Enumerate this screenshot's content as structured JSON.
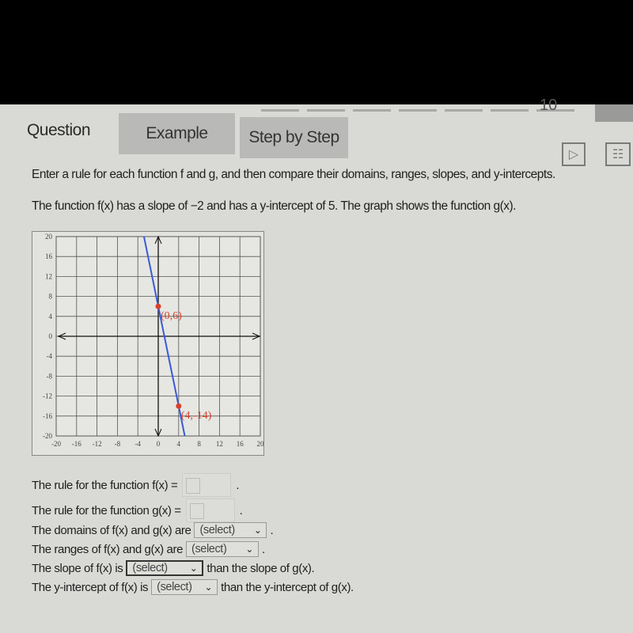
{
  "progress": {
    "visible_number": "10"
  },
  "tabs": [
    {
      "label": "Question"
    },
    {
      "label": "Example"
    },
    {
      "label": "Step by Step"
    }
  ],
  "icons": {
    "play": "play-icon",
    "book": "book-icon"
  },
  "instructions": {
    "line1": "Enter a rule for each function f and g, and then compare their domains, ranges, slopes, and y-intercepts.",
    "line2": "The function f(x) has a slope of −2 and has a y-intercept of 5. The graph shows the function g(x)."
  },
  "chart_data": {
    "type": "line",
    "xlim": [
      -20,
      20
    ],
    "ylim": [
      -20,
      20
    ],
    "x_ticks": [
      -20,
      -16,
      -12,
      -8,
      -4,
      0,
      4,
      8,
      12,
      16,
      20
    ],
    "y_ticks": [
      20,
      16,
      12,
      8,
      4,
      0,
      -4,
      -8,
      -12,
      -16,
      -20
    ],
    "grid": true,
    "series": [
      {
        "points": [
          [
            0,
            6
          ],
          [
            4,
            -14
          ]
        ],
        "color": "#3b5bd6"
      }
    ],
    "annotations": [
      {
        "x": 0,
        "y": 6,
        "label": "(0,6)"
      },
      {
        "x": 4,
        "y": -14,
        "label": "(4,-14)"
      }
    ],
    "point_color": "#d9402a"
  },
  "questions": {
    "f_rule": "The rule for the function f(x) =",
    "g_rule": "The rule for the function g(x) =",
    "domains_pre": "The domains of f(x) and g(x) are",
    "ranges_pre": "The ranges of f(x) and g(x) are",
    "slope_pre": "The slope of f(x) is",
    "slope_post": "than the slope of g(x).",
    "yint_pre": "The y-intercept of f(x) is",
    "yint_post": "than the y-intercept of g(x).",
    "select_placeholder": "(select)",
    "period": "."
  }
}
